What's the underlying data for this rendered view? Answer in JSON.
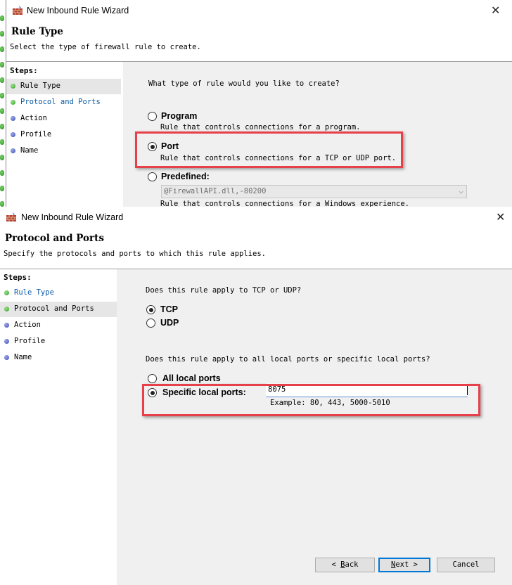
{
  "back_window": {
    "title": "New Inbound Rule Wizard",
    "header_title": "Rule Type",
    "header_subtitle": "Select the type of firewall rule to create.",
    "steps_title": "Steps:",
    "steps": [
      {
        "label": "Rule Type",
        "bullet": "green",
        "style": "normal",
        "active": true
      },
      {
        "label": "Protocol and Ports",
        "bullet": "green",
        "style": "link",
        "active": false
      },
      {
        "label": "Action",
        "bullet": "blue",
        "style": "normal",
        "active": false
      },
      {
        "label": "Profile",
        "bullet": "blue",
        "style": "normal",
        "active": false
      },
      {
        "label": "Name",
        "bullet": "blue",
        "style": "normal",
        "active": false
      }
    ],
    "question": "What type of rule would you like to create?",
    "options": [
      {
        "label": "Program",
        "desc": "Rule that controls connections for a program.",
        "checked": false
      },
      {
        "label": "Port",
        "desc": "Rule that controls connections for a TCP or UDP port.",
        "checked": true
      },
      {
        "label": "Predefined:",
        "desc": "Rule that controls connections for a Windows experience.",
        "checked": false
      }
    ],
    "predefined_value": "@FirewallAPI.dll,-80200"
  },
  "front_window": {
    "title": "New Inbound Rule Wizard",
    "header_title": "Protocol and Ports",
    "header_subtitle": "Specify the protocols and ports to which this rule applies.",
    "steps_title": "Steps:",
    "steps": [
      {
        "label": "Rule Type",
        "bullet": "green",
        "style": "link",
        "active": false
      },
      {
        "label": "Protocol and Ports",
        "bullet": "green",
        "style": "normal",
        "active": true
      },
      {
        "label": "Action",
        "bullet": "blue",
        "style": "normal",
        "active": false
      },
      {
        "label": "Profile",
        "bullet": "blue",
        "style": "normal",
        "active": false
      },
      {
        "label": "Name",
        "bullet": "blue",
        "style": "normal",
        "active": false
      }
    ],
    "protocol_question": "Does this rule apply to TCP or UDP?",
    "protocol_options": [
      {
        "label": "TCP",
        "checked": true
      },
      {
        "label": "UDP",
        "checked": false
      }
    ],
    "ports_question": "Does this rule apply to all local ports or specific local ports?",
    "ports_options": [
      {
        "label": "All local ports",
        "checked": false
      },
      {
        "label": "Specific local ports:",
        "checked": true
      }
    ],
    "ports_value": "8075",
    "ports_example": "Example: 80, 443, 5000-5010",
    "buttons": {
      "back_prefix": "< ",
      "back_mnemonic": "B",
      "back_rest": "ack",
      "next_mnemonic": "N",
      "next_rest": "ext >",
      "cancel": "Cancel"
    }
  },
  "colors": {
    "highlight_box": "#e8404a",
    "link_text": "#0b5aa6",
    "content_bg": "#f0f0f0"
  },
  "icons": {
    "title_icon": "firewall-wizard-icon",
    "close": "close-icon"
  }
}
